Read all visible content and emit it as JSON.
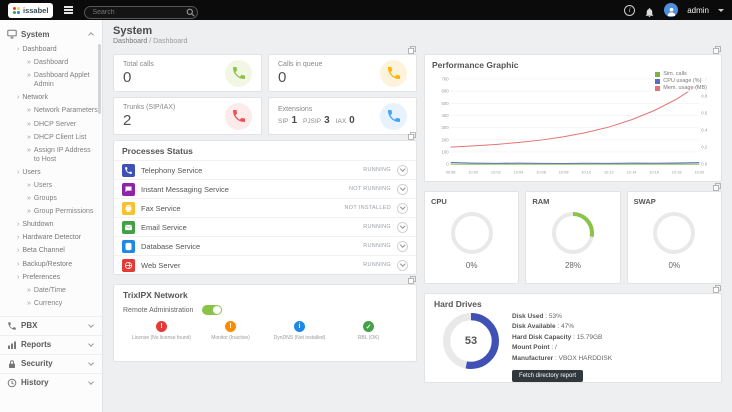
{
  "topbar": {
    "brand": "issabel",
    "search": {
      "placeholder": "Search"
    },
    "user": {
      "name": "admin"
    }
  },
  "sidebar": {
    "sections": [
      {
        "label": "System"
      },
      {
        "label": "PBX"
      },
      {
        "label": "Reports"
      },
      {
        "label": "Security"
      },
      {
        "label": "History"
      }
    ],
    "system_menu": [
      {
        "label": "Dashboard",
        "level": 1
      },
      {
        "label": "Dashboard",
        "level": 2
      },
      {
        "label": "Dashboard Applet Admin",
        "level": 2
      },
      {
        "label": "Network",
        "level": 1
      },
      {
        "label": "Network Parameters",
        "level": 2
      },
      {
        "label": "DHCP Server",
        "level": 2
      },
      {
        "label": "DHCP Client List",
        "level": 2
      },
      {
        "label": "Assign IP Address to Host",
        "level": 2
      },
      {
        "label": "Users",
        "level": 1
      },
      {
        "label": "Users",
        "level": 2
      },
      {
        "label": "Groups",
        "level": 2
      },
      {
        "label": "Group Permissions",
        "level": 2
      },
      {
        "label": "Shutdown",
        "level": 1
      },
      {
        "label": "Hardware Detector",
        "level": 1
      },
      {
        "label": "Beta Channel",
        "level": 1
      },
      {
        "label": "Backup/Restore",
        "level": 1
      },
      {
        "label": "Preferences",
        "level": 1
      },
      {
        "label": "Date/Time",
        "level": 2
      },
      {
        "label": "Currency",
        "level": 2
      }
    ]
  },
  "page": {
    "title": "System",
    "breadcrumb_parent": "Dashboard",
    "breadcrumb_sep": "/",
    "breadcrumb_current": "Dashboard"
  },
  "stats": {
    "total_calls": {
      "label": "Total calls",
      "value": "0",
      "color": "#8BC34A",
      "tint": "#f1f7e3"
    },
    "calls_in_queue": {
      "label": "Calls in queue",
      "value": "0",
      "color": "#FFB300",
      "tint": "#fdf3dc"
    },
    "trunks": {
      "label": "Trunks (SIP/IAX)",
      "value": "2",
      "color": "#EF5350",
      "tint": "#fdeaea"
    },
    "extensions": {
      "label": "Extensions",
      "color": "#42A5F5",
      "tint": "#e7f2fd",
      "items": [
        {
          "label": "SIP",
          "value": "1"
        },
        {
          "label": "PJSIP",
          "value": "3"
        },
        {
          "label": "IAX",
          "value": "0"
        }
      ]
    }
  },
  "chart_data": {
    "type": "line",
    "title": "Performance Graphic",
    "x": [
      "09:58",
      "10:00",
      "10:02",
      "10:04",
      "10:06",
      "10:08",
      "10:10",
      "10:12",
      "10:14",
      "10:16",
      "10:18",
      "10:20"
    ],
    "series": [
      {
        "name": "Sim. calls",
        "color": "#7CB342",
        "axis": "right",
        "values": [
          0,
          0,
          0,
          0,
          0,
          0,
          0,
          0,
          0,
          0,
          0,
          0
        ]
      },
      {
        "name": "CPU usage (%)",
        "color": "#5C6BC0",
        "axis": "left",
        "values": [
          14,
          9,
          7,
          9,
          7,
          6,
          8,
          7,
          9,
          8,
          10,
          13
        ]
      },
      {
        "name": "Mem. usage (MB)",
        "color": "#E57373",
        "axis": "left",
        "values": [
          140,
          150,
          162,
          178,
          198,
          225,
          260,
          305,
          365,
          440,
          535,
          655
        ]
      }
    ],
    "left_axis": {
      "min": 0,
      "max": 700,
      "ticks": [
        0,
        100,
        200,
        300,
        400,
        500,
        600,
        700
      ]
    },
    "right_axis": {
      "min": 0,
      "max": 1,
      "ticks": [
        0,
        0.2,
        0.4,
        0.6,
        0.8,
        1
      ]
    },
    "legend_position": "top-right",
    "grid": true
  },
  "processes": {
    "title": "Processes Status",
    "items": [
      {
        "name": "Telephony Service",
        "status": "RUNNING",
        "color": "#3F51B5"
      },
      {
        "name": "Instant Messaging Service",
        "status": "NOT RUNNING",
        "color": "#8E24AA"
      },
      {
        "name": "Fax Service",
        "status": "NOT INSTALLED",
        "color": "#FBC02D"
      },
      {
        "name": "Email Service",
        "status": "RUNNING",
        "color": "#43A047"
      },
      {
        "name": "Database Service",
        "status": "RUNNING",
        "color": "#1E88E5"
      },
      {
        "name": "Web Server",
        "status": "RUNNING",
        "color": "#E53935"
      }
    ]
  },
  "gauges": [
    {
      "label": "CPU",
      "percent": 0,
      "display": "0%",
      "color": "#8BC34A"
    },
    {
      "label": "RAM",
      "percent": 28,
      "display": "28%",
      "color": "#8BC34A"
    },
    {
      "label": "SWAP",
      "percent": 0,
      "display": "0%",
      "color": "#8BC34A"
    }
  ],
  "trixipx": {
    "title": "TrixIPX Network",
    "remote_admin_label": "Remote Administration",
    "remote_admin_on": true,
    "indicators": [
      {
        "label": "License (No license found)",
        "glyph": "!",
        "color": "#e53935"
      },
      {
        "label": "Monitor (Inactive)",
        "glyph": "!",
        "color": "#FB8C00"
      },
      {
        "label": "DynDNS (Not installed)",
        "glyph": "i",
        "color": "#1E88E5"
      },
      {
        "label": "RBL (OK)",
        "glyph": "✓",
        "color": "#43A047"
      }
    ]
  },
  "hard_drives": {
    "title": "Hard Drives",
    "gauge": {
      "percent": 53,
      "display": "53",
      "color": "#4050b5"
    },
    "separator": ":",
    "details": [
      {
        "label": "Disk Used",
        "value": "53%"
      },
      {
        "label": "Disk Available",
        "value": "47%"
      },
      {
        "label": "Hard Disk Capacity",
        "value": "15.79GB"
      },
      {
        "label": "Mount Point",
        "value": "/"
      },
      {
        "label": "Manufacturer",
        "value": "VBOX HARDDISK"
      }
    ],
    "button_label": "Fetch directory report"
  }
}
